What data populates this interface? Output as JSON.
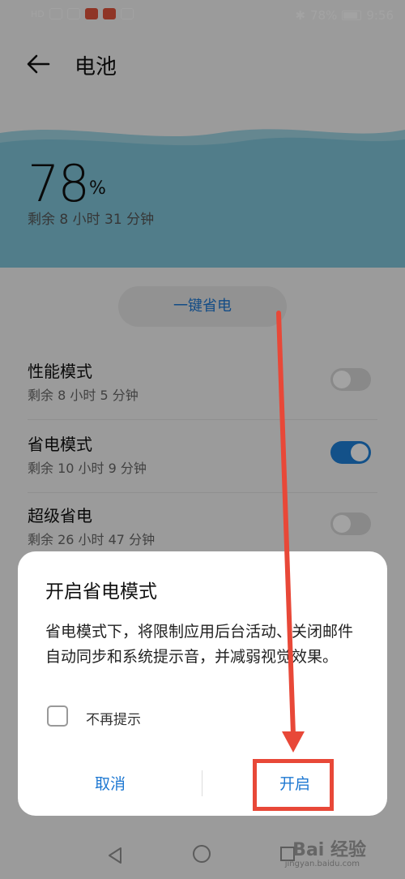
{
  "status_bar": {
    "battery": "78%",
    "time": "9:56"
  },
  "header": {
    "title": "电池"
  },
  "battery": {
    "percent": "78",
    "unit": "%",
    "remaining": "剩余 8 小时 31 分钟"
  },
  "onekey_button": "一键省电",
  "modes": [
    {
      "title": "性能模式",
      "sub": "剩余 8 小时 5 分钟",
      "enabled": false
    },
    {
      "title": "省电模式",
      "sub": "剩余 10 小时 9 分钟",
      "enabled": true
    },
    {
      "title": "超级省电",
      "sub": "剩余 26 小时 47 分钟",
      "enabled": false
    }
  ],
  "dialog": {
    "title": "开启省电模式",
    "body": "省电模式下，将限制应用后台活动、关闭邮件自动同步和系统提示音，并减弱视觉效果。",
    "checkbox_label": "不再提示",
    "cancel": "取消",
    "confirm": "开启"
  },
  "watermark": {
    "brand": "Bai 经验",
    "url": "jingyan.baidu.com"
  },
  "colors": {
    "accent": "#1e78d2",
    "annotation": "#e84838",
    "banner": "#7fc4d8"
  }
}
